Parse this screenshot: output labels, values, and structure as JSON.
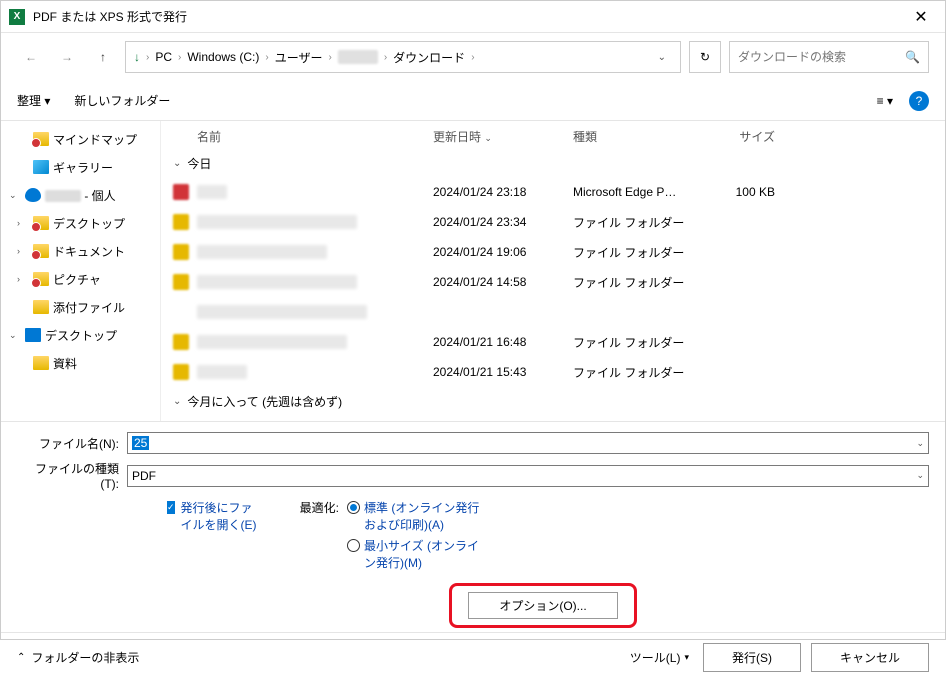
{
  "window": {
    "title": "PDF または XPS 形式で発行",
    "app_icon_letter": "X"
  },
  "breadcrumbs": [
    "PC",
    "Windows (C:)",
    "ユーザー",
    "",
    "ダウンロード"
  ],
  "search": {
    "placeholder": "ダウンロードの検索"
  },
  "toolbar": {
    "organize": "整理 ▾",
    "newfolder": "新しいフォルダー",
    "view": "≡ ▾",
    "help": "?"
  },
  "sidebar": [
    {
      "label": "マインドマップ",
      "level": 1,
      "icon": "folder-red",
      "chevron": ""
    },
    {
      "label": "ギャラリー",
      "level": 1,
      "icon": "gallery",
      "chevron": ""
    },
    {
      "label": "",
      "suffix": " - 個人",
      "level": 0,
      "icon": "onedrive",
      "chevron": "v",
      "blur": true
    },
    {
      "label": "デスクトップ",
      "level": 1,
      "icon": "folder-red",
      "chevron": ">"
    },
    {
      "label": "ドキュメント",
      "level": 1,
      "icon": "folder-red",
      "chevron": ">"
    },
    {
      "label": "ピクチャ",
      "level": 1,
      "icon": "folder-red",
      "chevron": ">"
    },
    {
      "label": "添付ファイル",
      "level": 1,
      "icon": "folder-yellow",
      "chevron": ""
    },
    {
      "label": "デスクトップ",
      "level": 0,
      "icon": "monitor",
      "chevron": "v"
    },
    {
      "label": "資料",
      "level": 1,
      "icon": "folder-yellow",
      "chevron": ""
    }
  ],
  "columns": {
    "name": "名前",
    "date": "更新日時",
    "type": "種類",
    "size": "サイズ"
  },
  "groups": {
    "today": "今日",
    "earlier": "今月に入って (先週は含めず)"
  },
  "files": [
    {
      "nameWidth": 30,
      "date": "2024/01/24 23:18",
      "type": "Microsoft Edge P…",
      "size": "100 KB",
      "iconColor": "#d13438"
    },
    {
      "nameWidth": 160,
      "date": "2024/01/24 23:34",
      "type": "ファイル フォルダー",
      "size": "",
      "iconColor": "#e6b800"
    },
    {
      "nameWidth": 130,
      "date": "2024/01/24 19:06",
      "type": "ファイル フォルダー",
      "size": "",
      "iconColor": "#e6b800"
    },
    {
      "nameWidth": 160,
      "date": "2024/01/24 14:58",
      "type": "ファイル フォルダー",
      "size": "",
      "iconColor": "#e6b800"
    },
    {
      "nameWidth": 170,
      "date": "",
      "type": "",
      "size": "",
      "iconColor": "#fff"
    },
    {
      "nameWidth": 150,
      "date": "2024/01/21 16:48",
      "type": "ファイル フォルダー",
      "size": "",
      "iconColor": "#e6b800"
    },
    {
      "nameWidth": 50,
      "date": "2024/01/21 15:43",
      "type": "ファイル フォルダー",
      "size": "",
      "iconColor": "#e6b800"
    }
  ],
  "form": {
    "filename_label": "ファイル名(N):",
    "filename_value": "25",
    "filetype_label": "ファイルの種類(T):",
    "filetype_value": "PDF"
  },
  "options": {
    "open_after_label": "発行後にファイルを開く(E)",
    "optimize_label": "最適化:",
    "standard_label": "標準 (オンライン発行および印刷)(A)",
    "minimum_label": "最小サイズ (オンライン発行)(M)",
    "options_btn": "オプション(O)..."
  },
  "footer": {
    "hide_folders": "フォルダーの非表示",
    "tools": "ツール(L)",
    "publish": "発行(S)",
    "cancel": "キャンセル"
  }
}
